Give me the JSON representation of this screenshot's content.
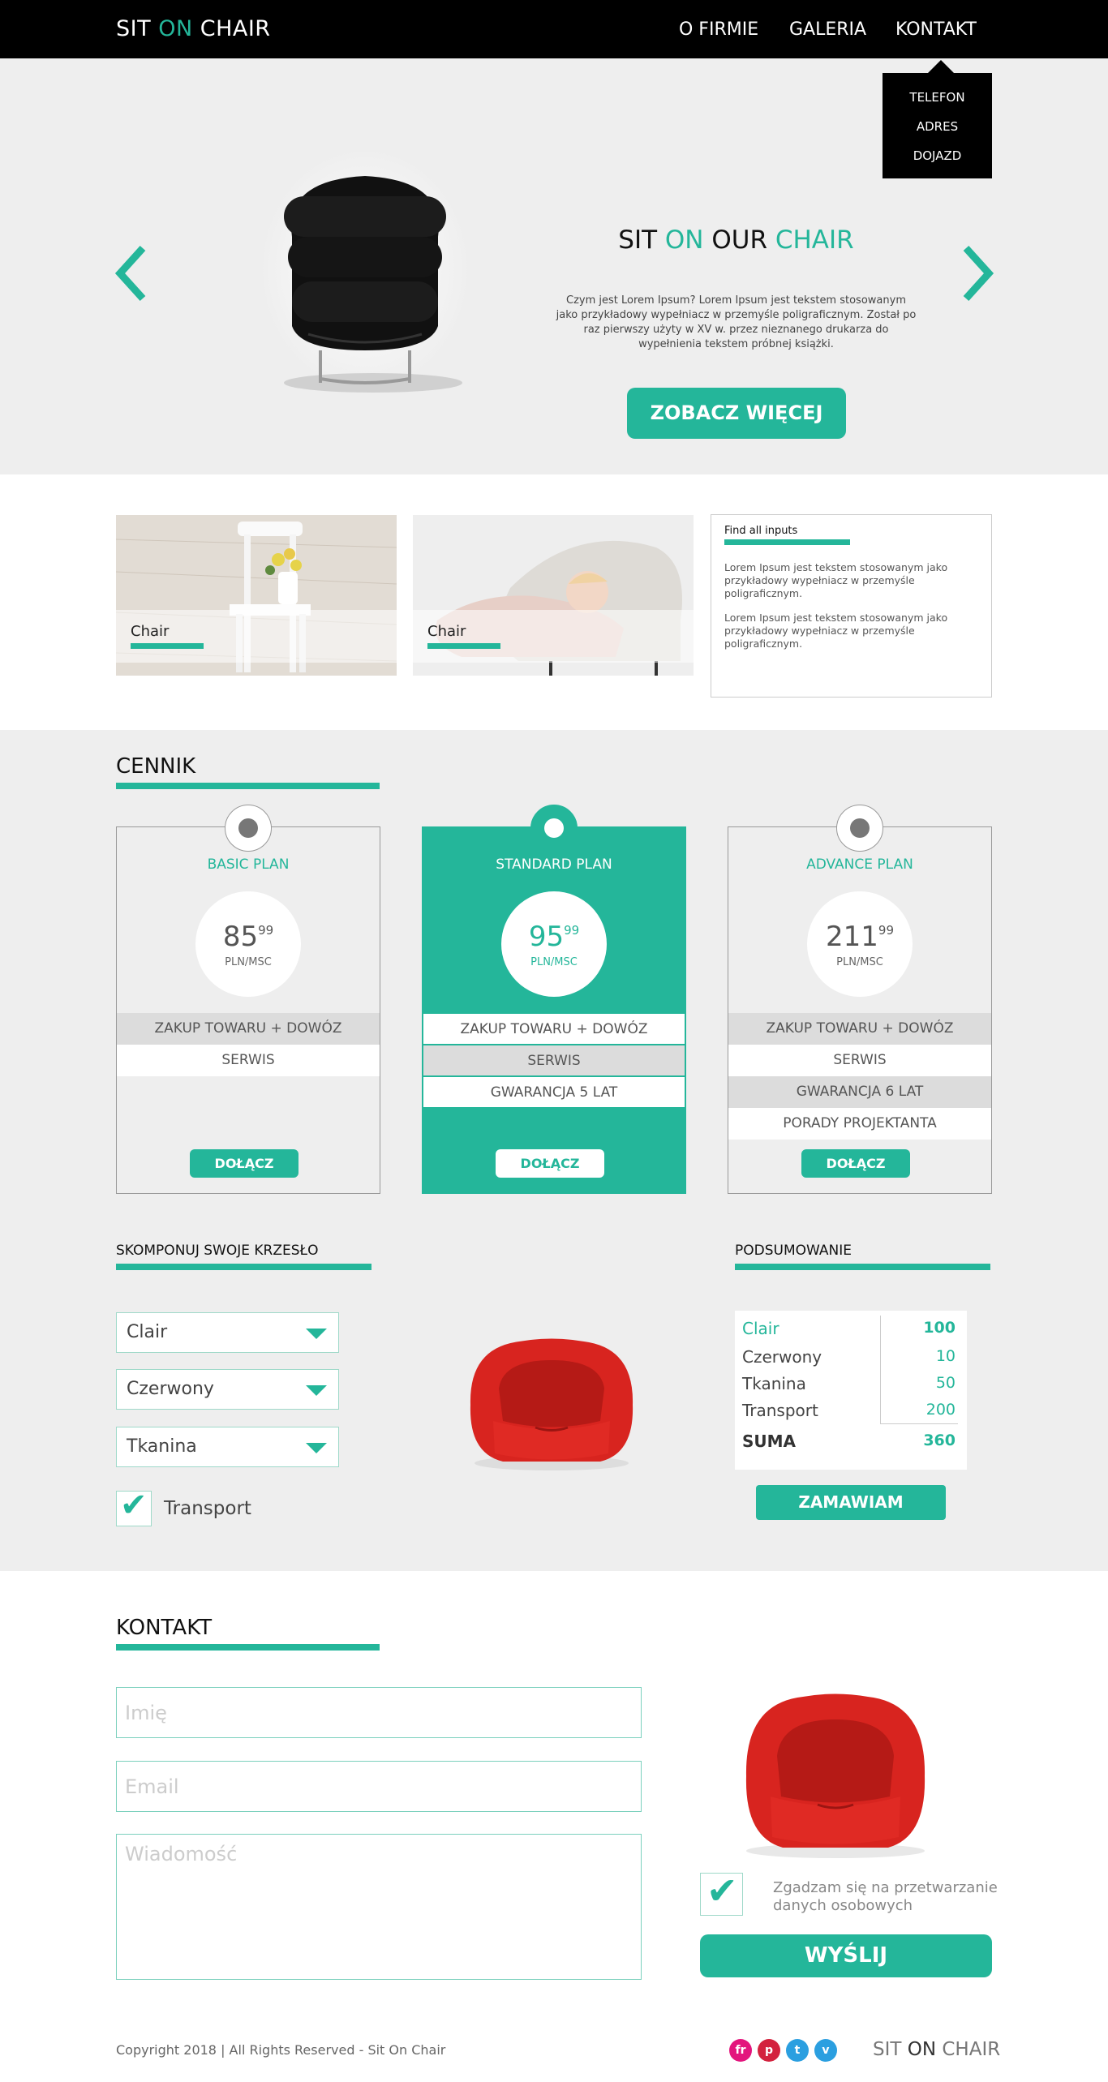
{
  "nav": {
    "logo": {
      "part1": "SIT ",
      "part2": "ON",
      "part3": " CHAIR"
    },
    "links": [
      "O FIRMIE",
      "GALERIA",
      "KONTAKT"
    ],
    "dropdown": [
      "TELEFON",
      "ADRES",
      "DOJAZD"
    ]
  },
  "hero": {
    "title": {
      "w1": "SIT ",
      "w2": "ON",
      "w3": " OUR ",
      "w4": "CHAIR"
    },
    "text": "Czym jest Lorem Ipsum? Lorem Ipsum jest tekstem stosowanym jako przykładowy wypełniacz w przemyśle poligraficznym. Został po raz pierwszy użyty w XV w. przez nieznanego drukarza do wypełnienia tekstem próbnej książki.",
    "button": "ZOBACZ WIĘCEJ"
  },
  "features": {
    "cards": [
      {
        "label": "Chair"
      },
      {
        "label": "Chair"
      }
    ],
    "info": {
      "title": "Find all inputs",
      "p1": "Lorem Ipsum jest tekstem stosowanym jako przykładowy wypełniacz w przemyśle poligraficznym.",
      "p2": "Lorem Ipsum jest tekstem stosowanym jako przykładowy wypełniacz w przemyśle poligraficznym."
    }
  },
  "pricing": {
    "title": "CENNIK",
    "plans": [
      {
        "name": "BASIC PLAN",
        "price": "85",
        "cents": "99",
        "unit": "PLN/MSC",
        "features": [
          "ZAKUP TOWARU + DOWÓZ",
          "SERWIS"
        ],
        "button": "DOŁĄCZ"
      },
      {
        "name": "STANDARD PLAN",
        "price": "95",
        "cents": "99",
        "unit": "PLN/MSC",
        "features": [
          "ZAKUP TOWARU + DOWÓZ",
          "SERWIS",
          "GWARANCJA 5 LAT"
        ],
        "button": "DOŁĄCZ"
      },
      {
        "name": "ADVANCE PLAN",
        "price": "211",
        "cents": "99",
        "unit": "PLN/MSC",
        "features": [
          "ZAKUP TOWARU + DOWÓZ",
          "SERWIS",
          "GWARANCJA 6 LAT",
          "PORADY PROJEKTANTA"
        ],
        "button": "DOŁĄCZ"
      }
    ]
  },
  "configurator": {
    "title": "SKOMPONUJ SWOJE KRZESŁO",
    "selects": [
      "Clair",
      "Czerwony",
      "Tkanina"
    ],
    "transport_label": "Transport",
    "transport_checked": true
  },
  "summary": {
    "title": "PODSUMOWANIE",
    "rows": [
      {
        "label": "Clair",
        "value": "100"
      },
      {
        "label": "Czerwony",
        "value": "10"
      },
      {
        "label": "Tkanina",
        "value": "50"
      },
      {
        "label": "Transport",
        "value": "200"
      }
    ],
    "total_label": "SUMA",
    "total_value": "360",
    "button": "ZAMAWIAM"
  },
  "contact": {
    "title": "KONTAKT",
    "name_placeholder": "Imię",
    "email_placeholder": "Email",
    "message_placeholder": "Wiadomość",
    "consent": "Zgadzam się na przetwarzanie danych osobowych",
    "button": "WYŚLIJ"
  },
  "footer": {
    "copyright": "Copyright 2018 | All Rights Reserved - Sit On Chair",
    "social": [
      {
        "icon": "fr",
        "color": "#e3157d"
      },
      {
        "icon": "p",
        "color": "#d3223e"
      },
      {
        "icon": "t",
        "color": "#2b9fe0"
      },
      {
        "icon": "v",
        "color": "#2b9fe0"
      }
    ],
    "logo": {
      "part1": "SIT ",
      "part2": "ON",
      "part3": " CHAIR"
    }
  },
  "colors": {
    "accent": "#24b69a",
    "nav_bg": "#000000",
    "section_bg": "#eeeeee"
  }
}
